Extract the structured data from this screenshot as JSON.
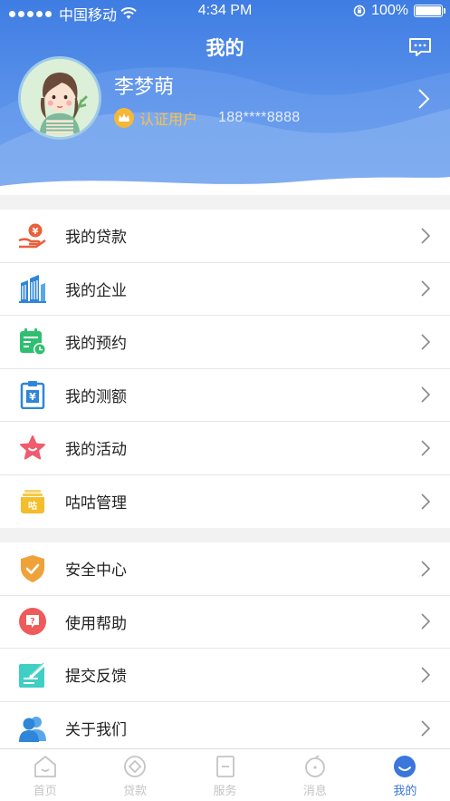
{
  "status_bar": {
    "carrier": "中国移动",
    "time": "4:34 PM",
    "battery": "100%"
  },
  "header": {
    "title": "我的",
    "message_icon": "chat-bubble-icon"
  },
  "profile": {
    "name": "李梦萌",
    "badge_label": "认证用户",
    "phone": "188****8888",
    "avatar_icon": "avatar-girl-illustration"
  },
  "menu_group_1": [
    {
      "label": "我的贷款",
      "icon": "loan-hand-icon",
      "color": "#e8603a"
    },
    {
      "label": "我的企业",
      "icon": "building-icon",
      "color": "#2f86d8"
    },
    {
      "label": "我的预约",
      "icon": "calendar-clock-icon",
      "color": "#2fbf71"
    },
    {
      "label": "我的测额",
      "icon": "clipboard-yen-icon",
      "color": "#2f86d8"
    },
    {
      "label": "我的活动",
      "icon": "star-icon",
      "color": "#f05b6e"
    },
    {
      "label": "咕咕管理",
      "icon": "gugu-box-icon",
      "color": "#f3bd2b"
    }
  ],
  "menu_group_2": [
    {
      "label": "安全中心",
      "icon": "shield-check-icon",
      "color": "#f0a23a"
    },
    {
      "label": "使用帮助",
      "icon": "help-question-icon",
      "color": "#ef5a5a"
    },
    {
      "label": "提交反馈",
      "icon": "feedback-edit-icon",
      "color": "#3fcfc4"
    },
    {
      "label": "关于我们",
      "icon": "users-icon",
      "color": "#2f86d8"
    }
  ],
  "tabbar": [
    {
      "label": "首页",
      "icon": "home-icon",
      "active": false
    },
    {
      "label": "贷款",
      "icon": "loan-icon",
      "active": false
    },
    {
      "label": "服务",
      "icon": "service-icon",
      "active": false
    },
    {
      "label": "消息",
      "icon": "message-icon",
      "active": false
    },
    {
      "label": "我的",
      "icon": "profile-icon",
      "active": true
    }
  ],
  "colors": {
    "primary": "#3f7de3",
    "badge": "#f7c04c",
    "tab_active": "#3a76db",
    "tab_inactive": "#c4c4c4"
  }
}
